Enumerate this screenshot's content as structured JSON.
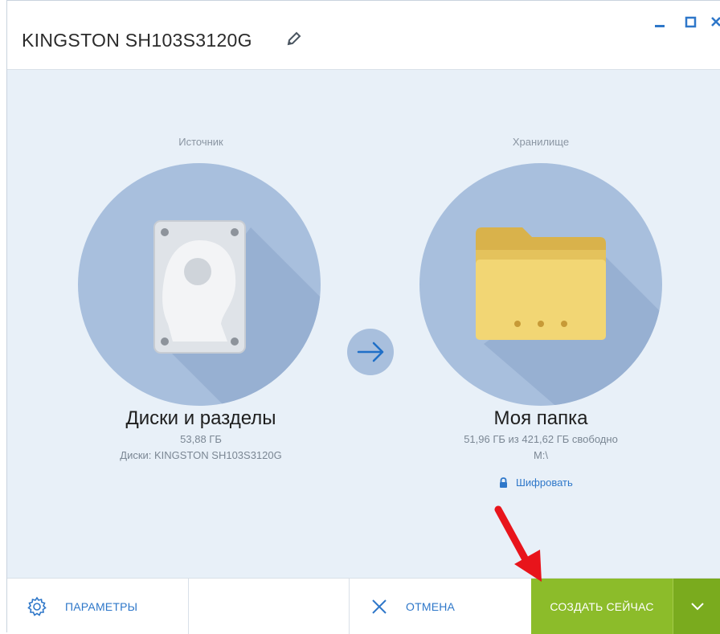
{
  "window": {
    "title": "KINGSTON SH103S3120G"
  },
  "source": {
    "caption": "Источник",
    "name": "Диски и разделы",
    "size": "53,88 ГБ",
    "details": "Диски: KINGSTON SH103S3120G"
  },
  "destination": {
    "caption": "Хранилище",
    "name": "Моя папка",
    "free_space": "51,96 ГБ из 421,62 ГБ свободно",
    "path": "M:\\",
    "encrypt_label": "Шифровать"
  },
  "toolbar": {
    "params_label": "ПАРАМЕТРЫ",
    "cancel_label": "ОТМЕНА",
    "create_label": "СОЗДАТЬ СЕЙЧАС"
  },
  "colors": {
    "accent_green": "#8cbc2a",
    "link_blue": "#2e77c9",
    "circle_blue": "#a8bfdd",
    "content_bg": "#e8f0f8",
    "annotation_red": "#e8141b"
  },
  "icons": [
    "edit-icon",
    "minimize-icon",
    "maximize-icon",
    "close-icon",
    "hard-drive-icon",
    "arrow-right-icon",
    "folder-icon",
    "lock-icon",
    "gear-icon",
    "cancel-x-icon",
    "chevron-down-icon"
  ]
}
